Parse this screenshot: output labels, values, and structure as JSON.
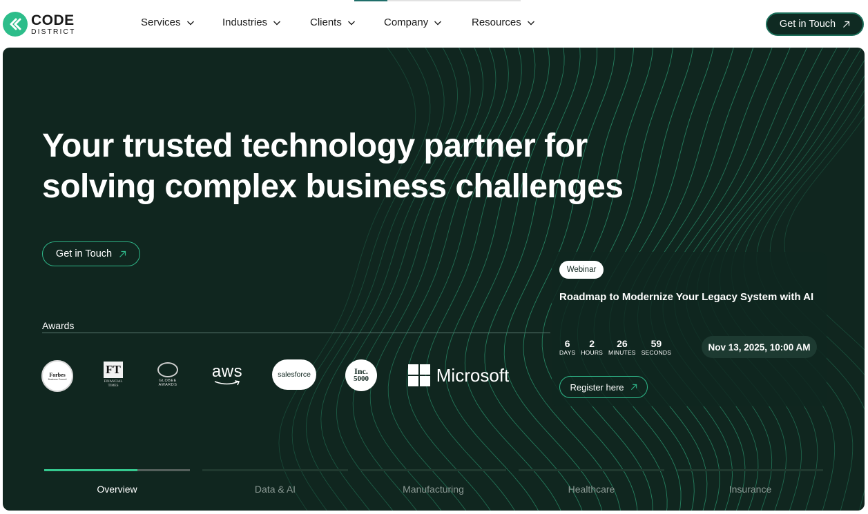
{
  "header": {
    "logo": {
      "top": "CODE",
      "bottom": "DISTRICT"
    },
    "nav": [
      {
        "label": "Services"
      },
      {
        "label": "Industries"
      },
      {
        "label": "Clients"
      },
      {
        "label": "Company"
      },
      {
        "label": "Resources"
      }
    ],
    "cta_label": "Get in Touch"
  },
  "hero": {
    "headline_line1": "Your trusted technology partner for",
    "headline_line2": "solving complex business challenges",
    "cta_label": "Get in Touch",
    "awards_label": "Awards",
    "awards": {
      "forbes": {
        "name": "Forbes",
        "caption": "Business Council"
      },
      "ft": {
        "name": "FT",
        "caption_line1": "FINANCIAL",
        "caption_line2": "TIMES"
      },
      "globee": {
        "caption_line1": "GLOBEE",
        "caption_line2": "AWARDS"
      },
      "aws": {
        "name": "aws"
      },
      "salesforce": {
        "name": "salesforce"
      },
      "inc": {
        "line1": "Inc.",
        "line2": "5000"
      },
      "microsoft": {
        "name": "Microsoft"
      }
    }
  },
  "webinar": {
    "badge": "Webinar",
    "title": "Roadmap to Modernize Your Legacy System with AI",
    "countdown": [
      {
        "value": "6",
        "label": "DAYS"
      },
      {
        "value": "2",
        "label": "HOURS"
      },
      {
        "value": "26",
        "label": "MINUTES"
      },
      {
        "value": "59",
        "label": "SECONDS"
      }
    ],
    "date": "Nov 13, 2025, 10:00 AM",
    "register_label": "Register here"
  },
  "tabs": [
    {
      "label": "Overview",
      "active": true,
      "progress": 0.64
    },
    {
      "label": "Data & AI",
      "active": false
    },
    {
      "label": "Manufacturing",
      "active": false
    },
    {
      "label": "Healthcare",
      "active": false
    },
    {
      "label": "Insurance",
      "active": false
    }
  ],
  "colors": {
    "hero_bg": "#10261f",
    "accent": "#2fb88a",
    "logo_mark": "#2dbd8a"
  }
}
